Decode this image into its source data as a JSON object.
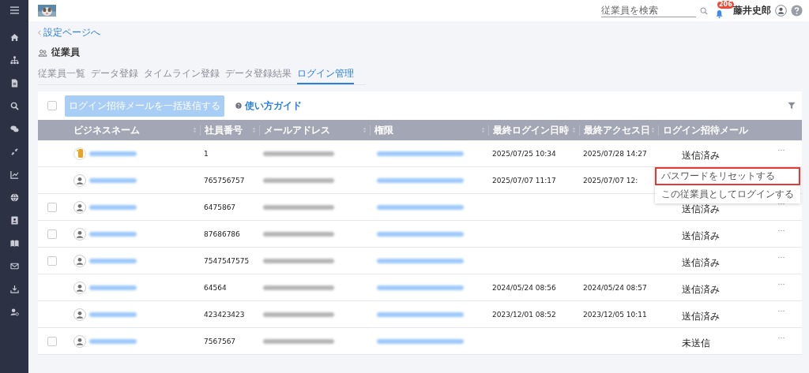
{
  "header": {
    "search": {
      "placeholder": "従業員を検索"
    },
    "notifications": {
      "count": "206"
    },
    "user": {
      "name": "藤井史郎"
    }
  },
  "back_link": "設定ページへ",
  "page_title": "従業員",
  "tabs": [
    {
      "label": "従業員一覧",
      "selected": false
    },
    {
      "label": "データ登録",
      "selected": false
    },
    {
      "label": "タイムライン登録",
      "selected": false
    },
    {
      "label": "データ登録結果",
      "selected": false
    },
    {
      "label": "ログイン管理",
      "selected": true
    }
  ],
  "toolbar": {
    "select_all": {
      "checked": false
    },
    "bulk_button": {
      "label": "ログイン招待メールを一括送信する",
      "disabled": true
    },
    "guide_link": "使い方ガイド"
  },
  "table": {
    "columns": [
      "ビジネスネーム",
      "社員番号",
      "メールアドレス",
      "権限",
      "最終ログイン日時",
      "最終アクセス日",
      "ログイン招待メール"
    ],
    "rows": [
      {
        "kind": "plain",
        "custom_avatar": true,
        "employee_no": "1",
        "last_login": "2025/07/25 10:34",
        "last_access": "2025/07/28 14:27",
        "invite": "送信済み"
      },
      {
        "kind": "plain",
        "custom_avatar": false,
        "employee_no": "765756757",
        "last_login": "2025/07/07 11:17",
        "last_access": "2025/07/07 12:"
      },
      {
        "kind": "selectable",
        "checked": false,
        "custom_avatar": false,
        "employee_no": "6475867",
        "invite": "送信済み"
      },
      {
        "kind": "selectable",
        "checked": false,
        "custom_avatar": false,
        "employee_no": "87686786",
        "invite": "送信済み"
      },
      {
        "kind": "selectable",
        "checked": false,
        "custom_avatar": false,
        "employee_no": "7547547575",
        "invite": "送信済み"
      },
      {
        "kind": "plain",
        "custom_avatar": false,
        "employee_no": "64564",
        "last_login": "2024/05/24 08:56",
        "last_access": "2024/05/24 08:57",
        "invite": "送信済み"
      },
      {
        "kind": "plain",
        "custom_avatar": false,
        "employee_no": "423423423",
        "last_login": "2023/12/01 08:52",
        "last_access": "2023/12/05 10:11",
        "invite": "送信済み"
      },
      {
        "kind": "selectable",
        "checked": false,
        "custom_avatar": false,
        "employee_no": "7567567",
        "invite": "未送信"
      }
    ]
  },
  "context_menu": {
    "items": [
      {
        "label": "パスワードをリセットする",
        "highlighted": true
      },
      {
        "label": "この従業員としてログインする",
        "highlighted": false
      }
    ]
  }
}
